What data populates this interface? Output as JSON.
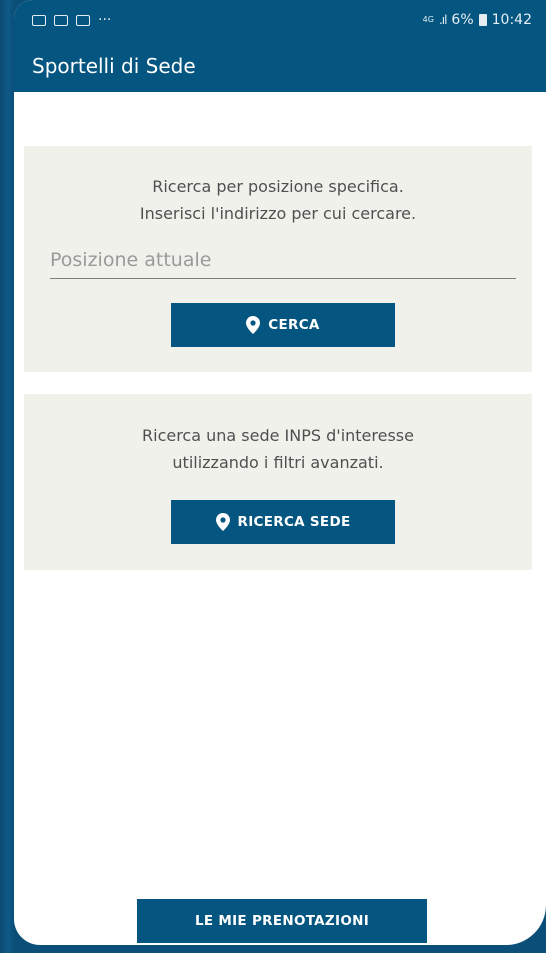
{
  "status_bar": {
    "left_icons": [
      "mail-icon",
      "image-icon",
      "screenshot-icon"
    ],
    "overflow": "···",
    "network": "4G",
    "battery": "6%",
    "time": "10:42"
  },
  "app_bar": {
    "title": "Sportelli di Sede"
  },
  "location_card": {
    "line1": "Ricerca per posizione specifica.",
    "line2": "Inserisci l'indirizzo per cui cercare.",
    "field_placeholder": "Posizione attuale",
    "button_label": "CERCA",
    "button_icon": "location-pin-icon"
  },
  "office_card": {
    "line1": "Ricerca una sede INPS d'interesse",
    "line2": "utilizzando i filtri avanzati.",
    "button_label": "RICERCA SEDE",
    "button_icon": "location-pin-icon"
  },
  "bottom": {
    "button_label": "LE MIE PRENOTAZIONI"
  },
  "colors": {
    "primary": "#045680",
    "card_bg": "#f1f1ec",
    "text": "#505050"
  }
}
